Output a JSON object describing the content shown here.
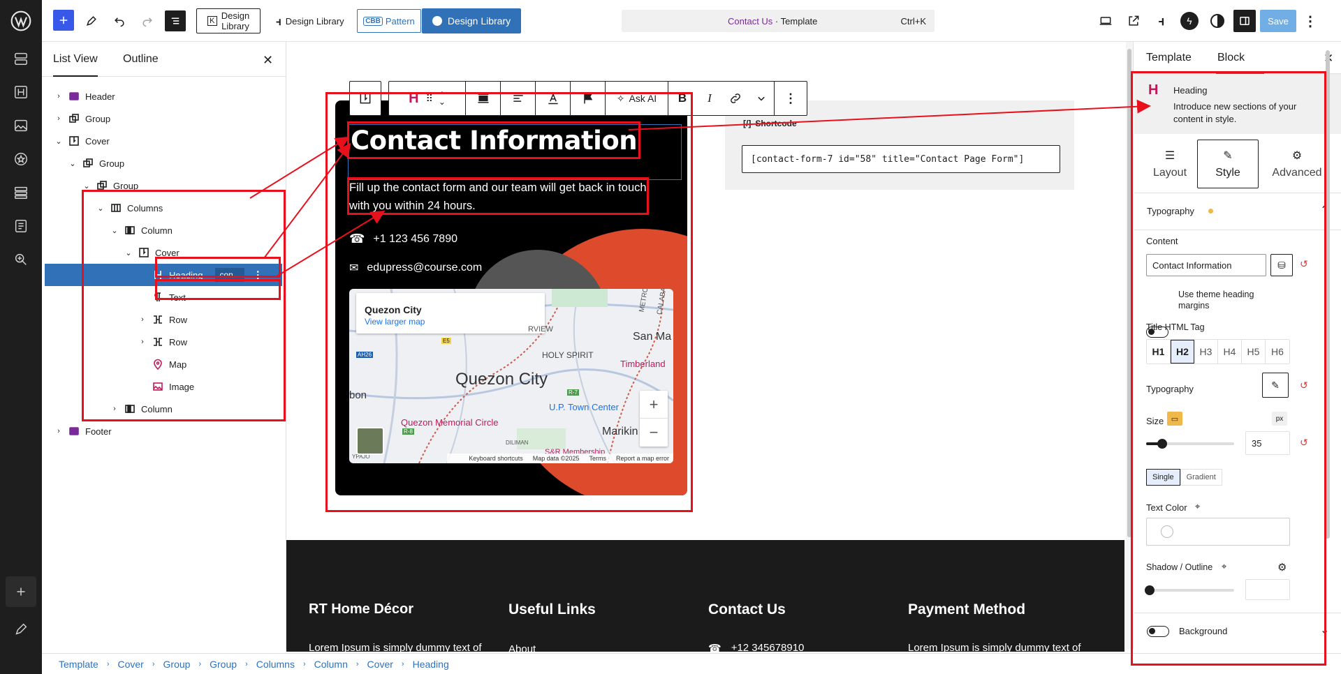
{
  "topbar": {
    "design_library_box": "Design\nLibrary",
    "design_library_link": "Design Library",
    "pattern_badge": "CBB",
    "pattern_label": "Pattern",
    "design_library_btn": "Design Library",
    "command": {
      "title": "Contact Us",
      "sep": " · ",
      "suffix": "Template",
      "shortcut": "Ctrl+K"
    },
    "save": "Save"
  },
  "list_view": {
    "tabs": [
      "List View",
      "Outline"
    ],
    "items": [
      {
        "label": "Header",
        "level": 0,
        "chev": "›",
        "icon": "template-part-icon"
      },
      {
        "label": "Group",
        "level": 0,
        "chev": "›",
        "icon": "group-icon"
      },
      {
        "label": "Cover",
        "level": 0,
        "chev": "⌄",
        "icon": "cover-icon"
      },
      {
        "label": "Group",
        "level": 1,
        "chev": "⌄",
        "icon": "group-icon"
      },
      {
        "label": "Group",
        "level": 2,
        "chev": "⌄",
        "icon": "group-icon"
      },
      {
        "label": "Columns",
        "level": 3,
        "chev": "⌄",
        "icon": "columns-icon"
      },
      {
        "label": "Column",
        "level": 4,
        "chev": "⌄",
        "icon": "column-icon"
      },
      {
        "label": "Cover",
        "level": 5,
        "chev": "⌄",
        "icon": "cover-icon"
      },
      {
        "label": "Heading",
        "level": 6,
        "chev": "",
        "icon": "heading-icon",
        "selected": true,
        "badge": "con..."
      },
      {
        "label": "Text",
        "level": 6,
        "chev": "",
        "icon": "paragraph-icon"
      },
      {
        "label": "Row",
        "level": 6,
        "chev": "›",
        "icon": "row-icon"
      },
      {
        "label": "Row",
        "level": 6,
        "chev": "›",
        "icon": "row-icon"
      },
      {
        "label": "Map",
        "level": 6,
        "chev": "",
        "icon": "map-pin-icon"
      },
      {
        "label": "Image",
        "level": 6,
        "chev": "",
        "icon": "image-icon"
      },
      {
        "label": "Column",
        "level": 4,
        "chev": "›",
        "icon": "column-icon"
      },
      {
        "label": "Footer",
        "level": 0,
        "chev": "›",
        "icon": "template-part-icon"
      }
    ]
  },
  "toolbar": {
    "ask_ai": "Ask AI"
  },
  "canvas": {
    "heading": "Contact Information",
    "text": "Fill up the contact form and our team will get back in touch with you within 24 hours.",
    "phone": "+1 123 456 7890",
    "email": "edupress@course.com",
    "map": {
      "place": "Quezon City",
      "larger": "View larger map",
      "big_label": "Quezon City",
      "labels": [
        "HOLY SPIRIT",
        "San Ma",
        "Timberland",
        "U.P. Town Center",
        "Quezon Memorial Circle",
        "Marikin",
        "bon",
        "RVIEW",
        "AH26",
        "E5",
        "R-7",
        "R-8",
        "DILIMAN",
        "S&R Membership",
        "METRO",
        "CALABA",
        "YPAJO"
      ],
      "footer": [
        "Keyboard shortcuts",
        "Map data ©2025",
        "Terms",
        "Report a map error"
      ],
      "zoom_in": "+",
      "zoom_out": "−"
    },
    "shortcode": {
      "label": "Shortcode",
      "value": "[contact-form-7 id=\"58\" title=\"Contact Page Form\"]"
    },
    "footer": {
      "cols": [
        "RT Home Décor",
        "Useful Links",
        "Contact Us",
        "Payment Method"
      ],
      "col1_text": "Lorem Ipsum is simply dummy text of",
      "col2_text": "About",
      "col3_text": "+12 345678910",
      "col4_text": "Lorem Ipsum is simply dummy text of"
    }
  },
  "settings": {
    "tabs": [
      "Template",
      "Block"
    ],
    "block_title": "Heading",
    "block_desc": "Introduce new sections of your content in style.",
    "subtabs": [
      "Layout",
      "Style",
      "Advanced"
    ],
    "typography_section": "Typography",
    "content_label": "Content",
    "content_value": "Contact Information",
    "theme_margins": "Use theme heading margins",
    "html_tag_label": "Title HTML Tag",
    "html_tags": [
      "H1",
      "H2",
      "H3",
      "H4",
      "H5",
      "H6"
    ],
    "typography_label": "Typography",
    "size_label": "Size",
    "size_unit": "px",
    "size_value": "35",
    "size_fraction": 0.18,
    "color_modes": [
      "Single",
      "Gradient"
    ],
    "text_color": "Text Color",
    "shadow": "Shadow / Outline",
    "background": "Background"
  },
  "breadcrumbs": [
    "Template",
    "Cover",
    "Group",
    "Group",
    "Columns",
    "Column",
    "Cover",
    "Heading"
  ],
  "colors": {
    "accent": "#3071b8",
    "annotation": "#e8101c",
    "orange": "#dd4b2c",
    "wp_blue": "#3858e9"
  }
}
